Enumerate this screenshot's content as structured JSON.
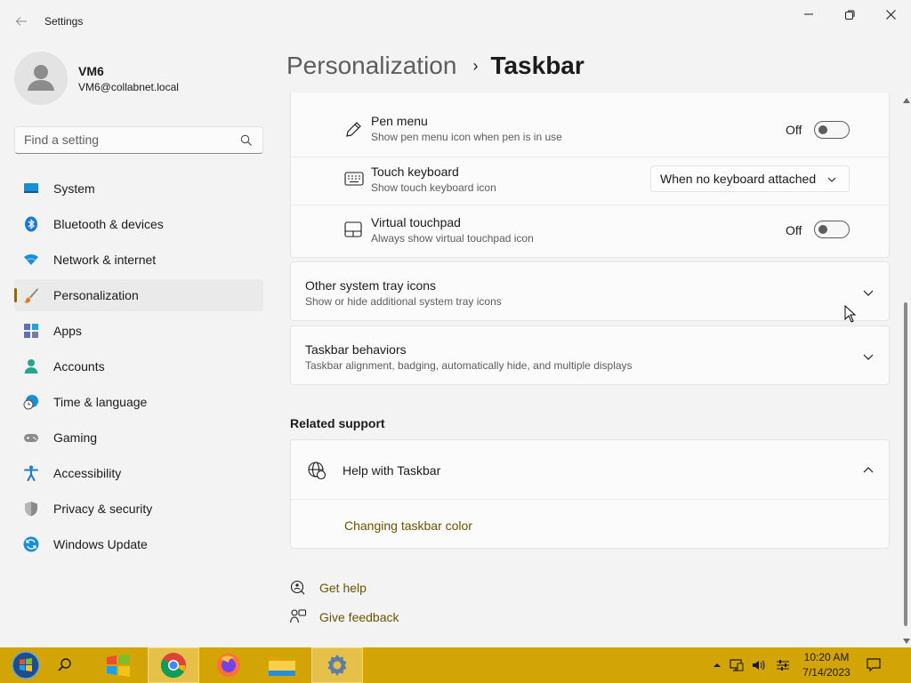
{
  "window": {
    "title": "Settings"
  },
  "profile": {
    "name": "VM6",
    "email": "VM6@collabnet.local"
  },
  "search": {
    "placeholder": "Find a setting"
  },
  "sidebar": {
    "items": [
      {
        "label": "System",
        "icon": "system-icon",
        "active": false
      },
      {
        "label": "Bluetooth & devices",
        "icon": "bluetooth-icon",
        "active": false
      },
      {
        "label": "Network & internet",
        "icon": "wifi-icon",
        "active": false
      },
      {
        "label": "Personalization",
        "icon": "paintbrush-icon",
        "active": true
      },
      {
        "label": "Apps",
        "icon": "apps-icon",
        "active": false
      },
      {
        "label": "Accounts",
        "icon": "person-icon",
        "active": false
      },
      {
        "label": "Time & language",
        "icon": "globe-clock-icon",
        "active": false
      },
      {
        "label": "Gaming",
        "icon": "gamepad-icon",
        "active": false
      },
      {
        "label": "Accessibility",
        "icon": "accessibility-icon",
        "active": false
      },
      {
        "label": "Privacy & security",
        "icon": "shield-icon",
        "active": false
      },
      {
        "label": "Windows Update",
        "icon": "update-icon",
        "active": false
      }
    ]
  },
  "breadcrumb": {
    "parent": "Personalization",
    "separator": "›",
    "current": "Taskbar"
  },
  "settings": {
    "pen_menu": {
      "title": "Pen menu",
      "subtitle": "Show pen menu icon when pen is in use",
      "state_label": "Off",
      "on": false
    },
    "touch_keyboard": {
      "title": "Touch keyboard",
      "subtitle": "Show touch keyboard icon",
      "selected": "When no keyboard attached"
    },
    "virtual_touchpad": {
      "title": "Virtual touchpad",
      "subtitle": "Always show virtual touchpad icon",
      "state_label": "Off",
      "on": false
    },
    "other_tray": {
      "title": "Other system tray icons",
      "subtitle": "Show or hide additional system tray icons"
    },
    "behaviors": {
      "title": "Taskbar behaviors",
      "subtitle": "Taskbar alignment, badging, automatically hide, and multiple displays"
    }
  },
  "related": {
    "heading": "Related support",
    "help_title": "Help with Taskbar",
    "help_link": "Changing taskbar color"
  },
  "footer": {
    "get_help": "Get help",
    "give_feedback": "Give feedback"
  },
  "taskbar": {
    "clock_time": "10:20 AM",
    "clock_date": "7/14/2023",
    "apps": [
      "start-orb-icon",
      "search-icon",
      "windows-logo-icon",
      "chrome-icon",
      "firefox-icon",
      "file-explorer-icon",
      "settings-gear-icon"
    ]
  },
  "colors": {
    "taskbar": "#d3a406",
    "accent_link": "#6b5300",
    "active_indicator": "#8a6a1a"
  }
}
